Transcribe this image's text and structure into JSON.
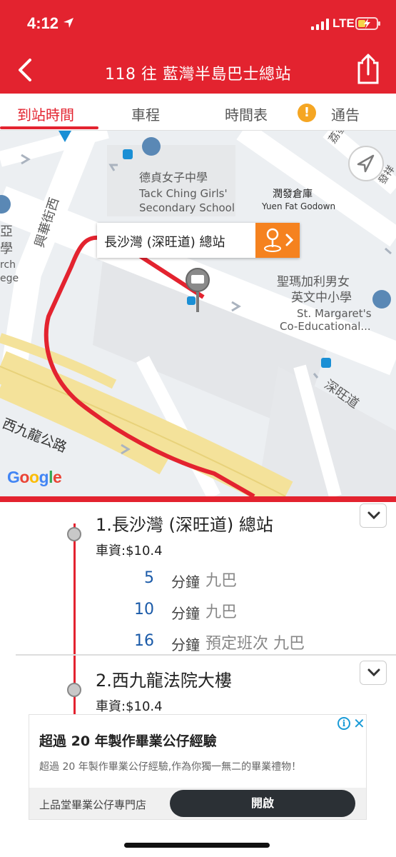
{
  "status_bar": {
    "time": "4:12",
    "network": "LTE",
    "icons": [
      "location-arrow-icon",
      "signal-icon",
      "battery-charging-icon"
    ]
  },
  "header": {
    "title": "118 往 藍灣半島巴士總站",
    "back_icon": "chevron-left-icon",
    "share_icon": "share-icon"
  },
  "tabs": [
    {
      "label": "到站時間",
      "active": true
    },
    {
      "label": "車程",
      "active": false
    },
    {
      "label": "時間表",
      "active": false
    },
    {
      "label": "通告",
      "active": false,
      "icon": "warning-icon"
    }
  ],
  "map": {
    "callout": {
      "label": "長沙灣 (深旺道) 總站",
      "button_icon": "bus-stop-arrow-icon"
    },
    "labels": {
      "school1_zh": "德貞女子中學",
      "school1_en_1": "Tack Ching Girls'",
      "school1_en_2": "Secondary School",
      "godown_zh": "潤發倉庫",
      "godown_en": "Yuen Fat Godown",
      "school2_zh_1": "聖瑪加利男女",
      "school2_zh_2": "英文中小學",
      "school2_en_1": "St. Margaret's",
      "school2_en_2": "Co-Educational...",
      "road1": "興華街西",
      "road2": "深旺道",
      "road3": "西九龍公路",
      "road4": "荔發",
      "road5": "發祥",
      "edge_1": "亞",
      "edge_2": "學",
      "edge_3": "rch",
      "edge_4": "ege"
    },
    "attribution": "Google",
    "colors": {
      "route": "#e3232f",
      "callout_button": "#f5821f"
    }
  },
  "stops": [
    {
      "name": "1.長沙灣 (深旺道) 總站",
      "fare": "車資:$10.4",
      "etas": [
        {
          "minutes": "5",
          "unit": "分鐘",
          "info": "九巴"
        },
        {
          "minutes": "10",
          "unit": "分鐘",
          "info": "九巴"
        },
        {
          "minutes": "16",
          "unit": "分鐘",
          "info": "預定班次 九巴"
        }
      ]
    },
    {
      "name": "2.西九龍法院大樓",
      "fare": "車資:$10.4",
      "etas": []
    }
  ],
  "ad": {
    "title": "超過 20 年製作畢業公仔經驗",
    "description": "超過 20 年製作畢業公仔經驗,作為你獨一無二的畢業禮物！",
    "brand": "上品堂畢業公仔專門店",
    "button": "開啟",
    "info_icon": "i",
    "close_icon": "✕"
  },
  "theme": {
    "primary": "#e3232f",
    "eta_blue": "#1a5aa8"
  }
}
